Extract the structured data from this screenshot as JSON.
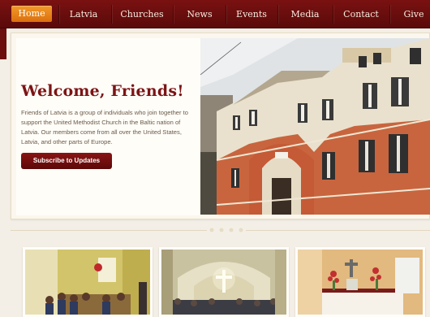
{
  "nav": {
    "items": [
      {
        "label": "Home"
      },
      {
        "label": "Latvia"
      },
      {
        "label": "Churches"
      },
      {
        "label": "News"
      },
      {
        "label": "Events"
      },
      {
        "label": "Media"
      },
      {
        "label": "Contact"
      },
      {
        "label": "Give"
      }
    ]
  },
  "hero": {
    "title": "Welcome, Friends!",
    "text": "Friends of Latvia is a group of individuals who join together to support the United Methodist Church in the Baltic nation of Latvia. Our members come from all over the United States, Latvia, and other parts of Europe.",
    "subscribe_label": "Subscribe to Updates"
  },
  "colors": {
    "nav_bg": "#6d0e0e",
    "accent": "#e8841b",
    "title": "#7c1414",
    "button": "#6e0d0d",
    "page_bg": "#f4efe6"
  }
}
